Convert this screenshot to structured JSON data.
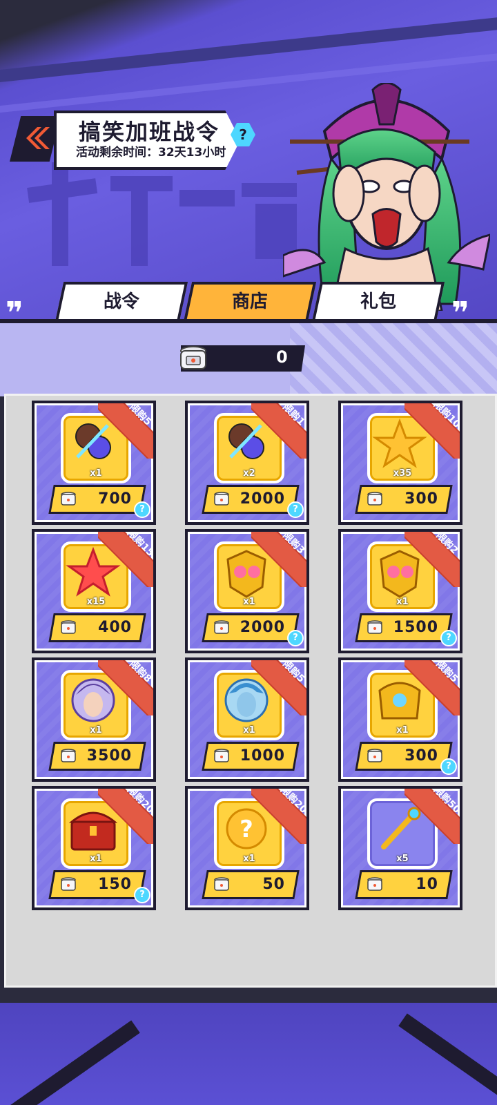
{
  "header": {
    "title": "搞笑加班战令",
    "subtitle": "活动剩余时间：32天13小时",
    "help_glyph": "?"
  },
  "tabs": [
    {
      "label": "战令",
      "active": false
    },
    {
      "label": "商店",
      "active": true
    },
    {
      "label": "礼包",
      "active": false
    }
  ],
  "currency": {
    "icon": "rice-cooker-icon",
    "value": "0"
  },
  "shop_items": [
    {
      "limit": "限购5",
      "qty": "x1",
      "price": "700",
      "item": "crystal-orb",
      "help": true
    },
    {
      "limit": "限购1",
      "qty": "x2",
      "price": "2000",
      "item": "crystal-orb",
      "help": true
    },
    {
      "limit": "限购10",
      "qty": "x35",
      "price": "300",
      "item": "gold-star",
      "help": false
    },
    {
      "limit": "限购15",
      "qty": "x15",
      "price": "400",
      "item": "red-star",
      "help": false
    },
    {
      "limit": "限购3",
      "qty": "x1",
      "price": "2000",
      "item": "golden-armor",
      "help": true
    },
    {
      "limit": "限购2",
      "qty": "x1",
      "price": "1500",
      "item": "golden-armor",
      "help": true
    },
    {
      "limit": "限购8",
      "qty": "x1",
      "price": "3500",
      "item": "hero-portrait-purple",
      "help": false
    },
    {
      "limit": "限购5",
      "qty": "x1",
      "price": "1000",
      "item": "hero-portrait-blue",
      "help": false
    },
    {
      "limit": "限购5",
      "qty": "x1",
      "price": "300",
      "item": "golden-chest-armor",
      "help": true
    },
    {
      "limit": "限购20",
      "qty": "x1",
      "price": "150",
      "item": "treasure-chest",
      "help": true
    },
    {
      "limit": "限购20",
      "qty": "x1",
      "price": "50",
      "item": "mystery-orb",
      "help": false
    },
    {
      "limit": "限购50",
      "qty": "x5",
      "price": "10",
      "item": "golden-wand",
      "help": false
    }
  ],
  "colors": {
    "accent": "#ffb43a",
    "ribbon": "#e35a44",
    "card": "#8177e8",
    "help": "#4ed7ff",
    "dark": "#1e1b30"
  }
}
